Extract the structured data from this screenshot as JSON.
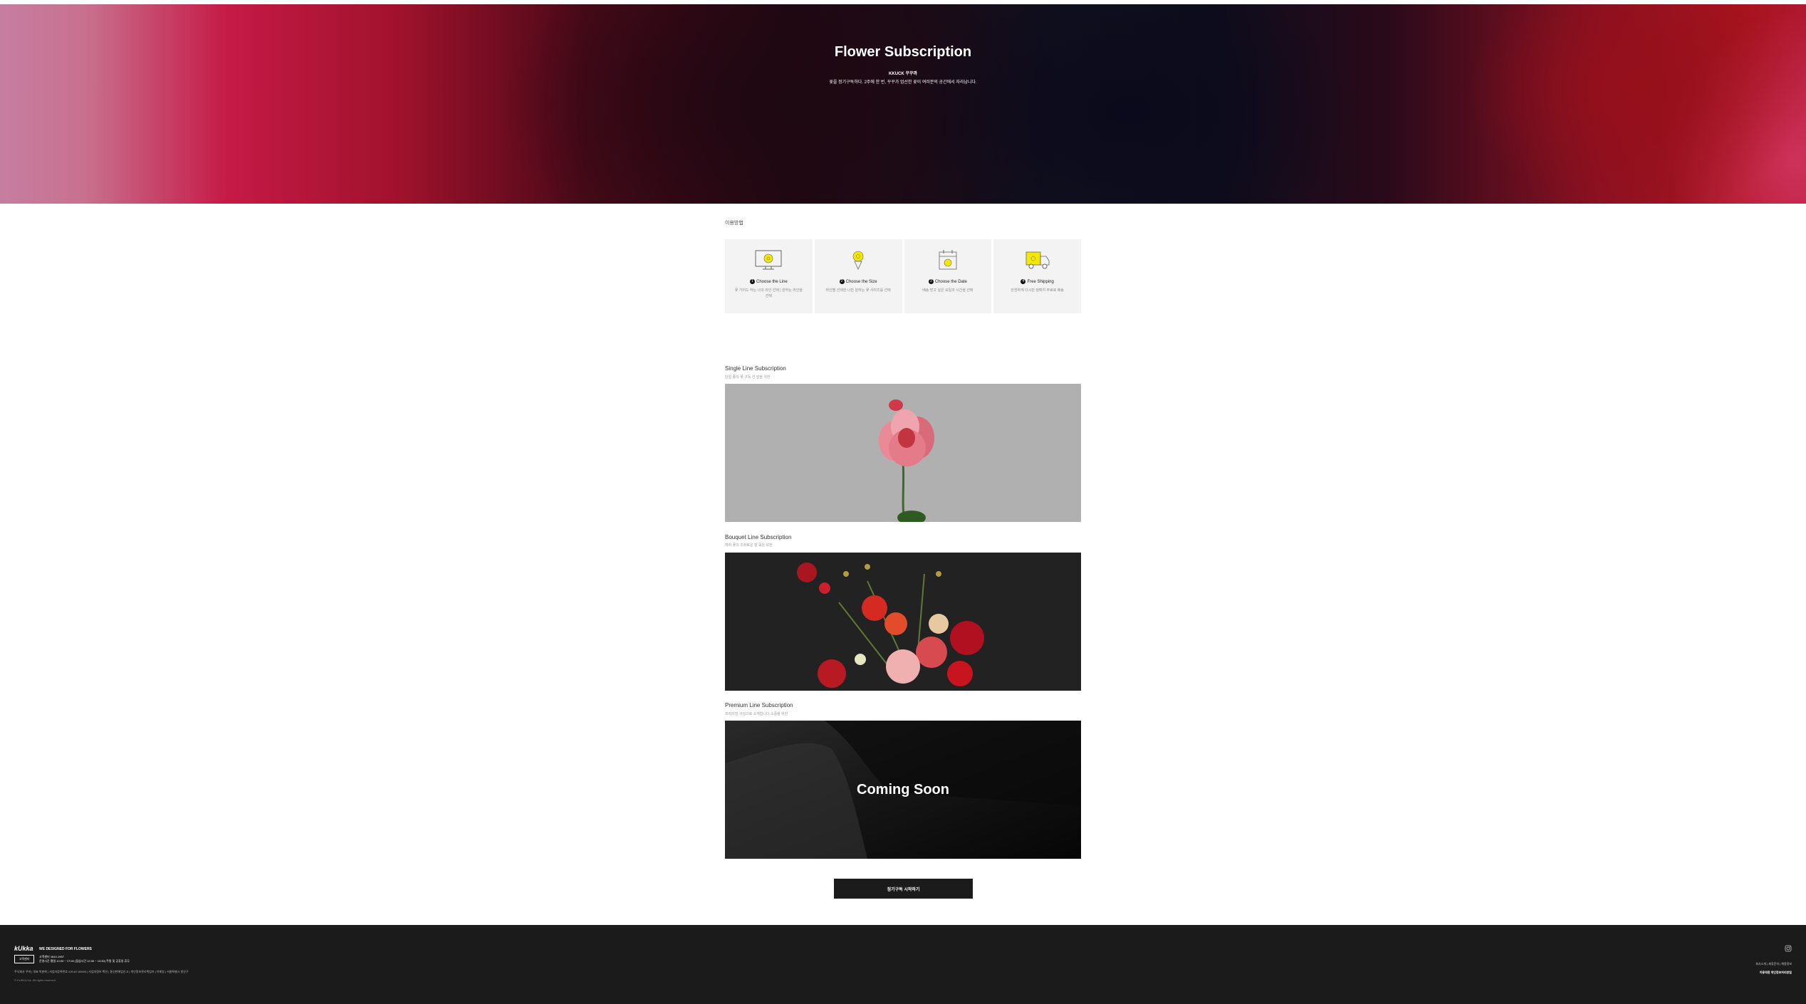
{
  "hero": {
    "title": "Flower Subscription",
    "brand": "KKUCK 꾸꾸까",
    "tagline": "꽃을 정기구독하다. 2주에 한 번, 꾸꾸가 엄선한 꽃이 여러분의 공간에서 자라납니다."
  },
  "how": {
    "title": "이용방법",
    "steps": [
      {
        "num": "1",
        "label": "Choose the Line",
        "desc": "꽃 가이드 하는 나의 라인 선택 | 원하는 라인을 선택",
        "icon": "flower-monitor-icon"
      },
      {
        "num": "2",
        "label": "Choose the Size",
        "desc": "라인별 선택한 나만 원하는 꽃 사이즈를 선택",
        "icon": "bouquet-icon"
      },
      {
        "num": "3",
        "label": "Choose the Date",
        "desc": "배송 받고 싶은 요일과 시간을 선택",
        "icon": "calendar-icon"
      },
      {
        "num": "4",
        "label": "Free Shipping",
        "desc": "안전하게 다시만 정확히 무료로 배송",
        "icon": "delivery-truck-icon"
      }
    ]
  },
  "subscriptions": [
    {
      "title": "Single Line Subscription",
      "desc": "단일 종의 꽃 구독 선 앞을 위한"
    },
    {
      "title": "Bouquet Line Subscription",
      "desc": "여러 꽃의 조화로운 잘 묶은 위한"
    },
    {
      "title": "Premium Line Subscription",
      "desc": "프리미엄 구성으로 소개합니다 소중을 위한",
      "overlay": "Coming Soon"
    }
  ],
  "cta_label": "정기구독 시작하기",
  "footer": {
    "logo": "kUkka",
    "slogan": "WE DESIGNED FOR FLOWERS",
    "badge": "고객센터",
    "cs_phone": "고객센터 1644-1957",
    "cs_hours": "운영시간 평일 10:00 ~ 17:00 (점심시간 12:30 ~ 13:30) 주말 및 공휴일 휴무",
    "company_info": "주식회사 꾸까 | 대표 박춘화 | 사업자등록번호 220-87-00000 | 사업자정보 확인 | 통신판매업신고 | 개인정보관리책임자 | 이메일 | 서울특별시 용산구",
    "copyright": "© KUKKA Inc. All rights reserved",
    "links_row1": "회사소개 | 제휴문의 | 채용정보",
    "links_row2": "이용약관  개인정보처리방침",
    "icon": "instagram-icon"
  }
}
